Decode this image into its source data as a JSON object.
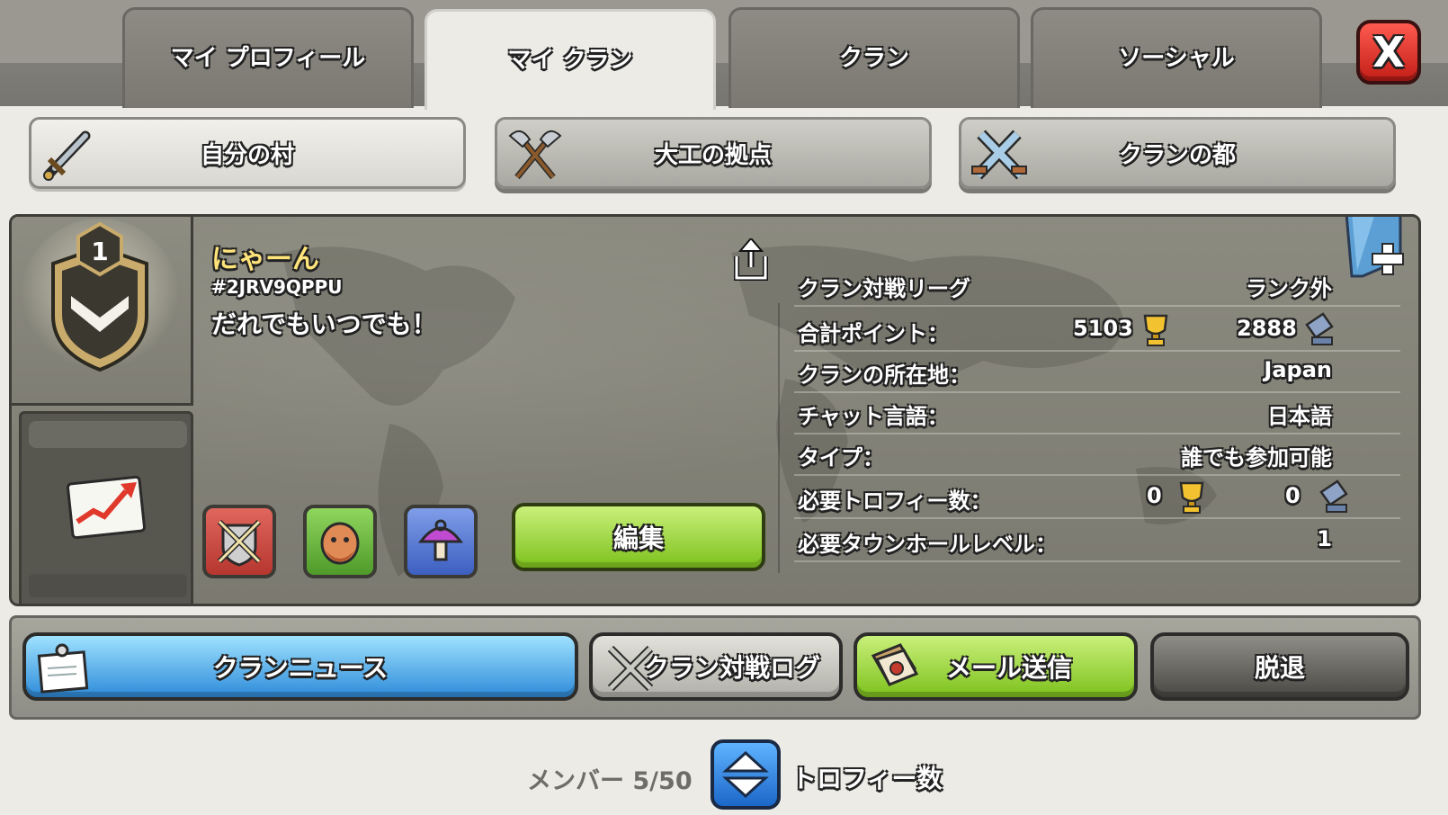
{
  "tabs": [
    {
      "label": "マイ プロフィール",
      "active": false
    },
    {
      "label": "マイ クラン",
      "active": true
    },
    {
      "label": "クラン",
      "active": false
    },
    {
      "label": "ソーシャル",
      "active": false
    }
  ],
  "close_label": "X",
  "subtabs": [
    {
      "label": "自分の村",
      "icon": "sword-icon",
      "active": true
    },
    {
      "label": "大工の拠点",
      "icon": "axes-icon",
      "active": false
    },
    {
      "label": "クランの都",
      "icon": "crossed-swords-icon",
      "active": false
    }
  ],
  "clan": {
    "badge_level": "1",
    "name": "にゃーん",
    "tag": "#2JRV9QPPU",
    "description": "だれでもいつでも！",
    "edit_label": "編集"
  },
  "info": {
    "war_league_label": "クラン対戦リーグ",
    "war_league_value": "ランク外",
    "total_points_label": "合計ポイント：",
    "total_points_home": "5103",
    "total_points_builder": "2888",
    "location_label": "クランの所在地：",
    "location_value": "Japan",
    "chat_language_label": "チャット言語：",
    "chat_language_value": "日本語",
    "type_label": "タイプ：",
    "type_value": "誰でも参加可能",
    "required_trophies_label": "必要トロフィー数：",
    "required_trophies_home": "0",
    "required_trophies_builder": "0",
    "required_th_label": "必要タウンホールレベル：",
    "required_th_value": "1"
  },
  "buttons": {
    "news": "クランニュース",
    "war_log": "クラン対戦ログ",
    "mail": "メール送信",
    "leave": "脱退"
  },
  "members": {
    "label": "メンバー 5/50",
    "sort_label": "トロフィー数"
  },
  "colors": {
    "accent_green": "#7dc11d",
    "accent_blue": "#2e8bd9",
    "close_red": "#c21e17",
    "clan_name_yellow": "#ffe47a"
  }
}
